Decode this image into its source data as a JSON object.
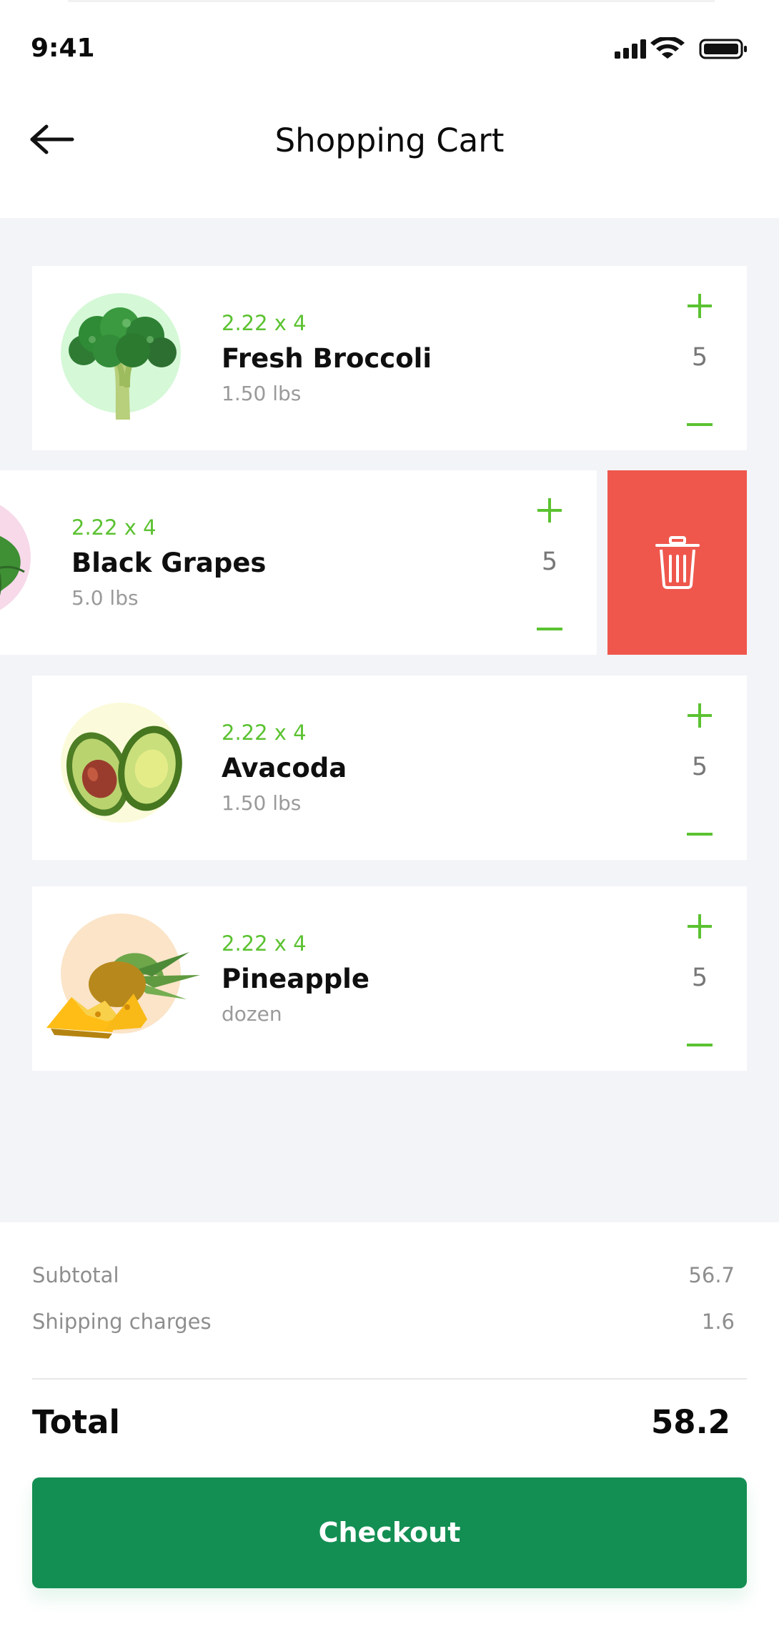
{
  "status_bar": {
    "time": "9:41"
  },
  "header": {
    "title": "Shopping Cart",
    "back_icon": "arrow-left-icon"
  },
  "items": [
    {
      "price": "2.22 x 4",
      "name": "Fresh Broccoli",
      "weight": "1.50 lbs",
      "quantity": "5",
      "thumb_color": "#d5f8d7"
    },
    {
      "price": "2.22 x 4",
      "name": "Black Grapes",
      "weight": "5.0 lbs",
      "quantity": "5",
      "thumb_color": "#f7d9ea"
    },
    {
      "price": "2.22 x 4",
      "name": "Avacoda",
      "weight": "1.50 lbs",
      "quantity": "5",
      "thumb_color": "#fbfbdb"
    },
    {
      "price": "2.22 x 4",
      "name": "Pineapple",
      "weight": "dozen",
      "quantity": "5",
      "thumb_color": "#fbe4c8"
    }
  ],
  "delete_action": {
    "icon": "trash-icon",
    "color": "#ef574d"
  },
  "summary": {
    "subtotal_label": "Subtotal",
    "subtotal_value": "56.7",
    "shipping_label": "Shipping charges",
    "shipping_value": "1.6",
    "total_label": "Total",
    "total_value": "58.2"
  },
  "checkout": {
    "label": "Checkout",
    "color": "#138f53"
  },
  "colors": {
    "accent_green": "#5bc231",
    "background": "#f3f4f8"
  }
}
